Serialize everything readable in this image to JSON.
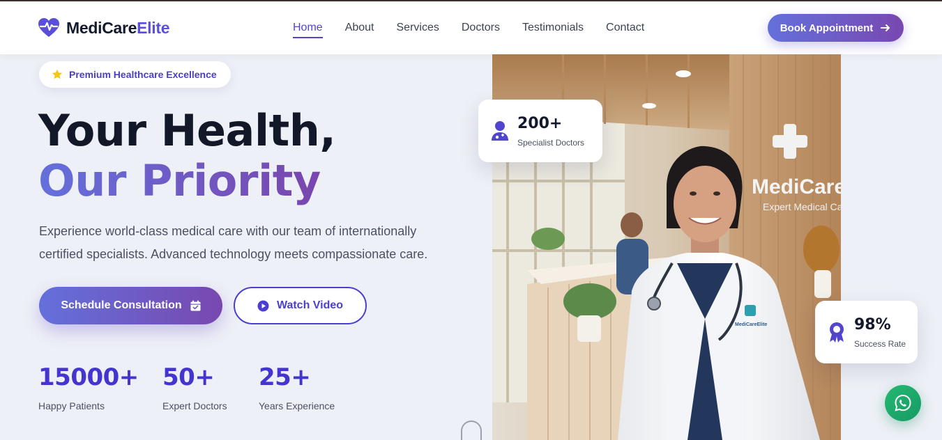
{
  "header": {
    "logo_main": "MediCare",
    "logo_accent": "Elite",
    "nav": [
      {
        "label": "Home",
        "active": true
      },
      {
        "label": "About"
      },
      {
        "label": "Services"
      },
      {
        "label": "Doctors"
      },
      {
        "label": "Testimonials"
      },
      {
        "label": "Contact"
      }
    ],
    "cta_label": "Book Appointment",
    "cta_icon": "arrow-right-icon"
  },
  "hero": {
    "badge": "Premium Healthcare Excellence",
    "badge_icon": "star-icon",
    "title_line1": "Your Health,",
    "title_line2": "Our Priority",
    "description": "Experience world-class medical care with our team of internationally certified specialists. Advanced technology meets compassionate care.",
    "primary_button": "Schedule Consultation",
    "primary_icon": "calendar-check-icon",
    "secondary_button": "Watch Video",
    "secondary_icon": "play-circle-icon",
    "stats": [
      {
        "value": "15000+",
        "label": "Happy Patients"
      },
      {
        "value": "50+",
        "label": "Expert Doctors"
      },
      {
        "value": "25+",
        "label": "Years Experience"
      }
    ]
  },
  "image": {
    "wall_brand": "MediCareElite",
    "wall_tagline": "Expert Medical Care",
    "coat_brand": "MediCareElite"
  },
  "cards": {
    "doctors": {
      "value": "200+",
      "label": "Specialist Doctors",
      "icon": "doctor-icon"
    },
    "success": {
      "value": "98%",
      "label": "Success Rate",
      "icon": "award-icon"
    }
  },
  "floating": {
    "whatsapp_icon": "whatsapp-icon"
  },
  "colors": {
    "accent": "#5145cd",
    "gradient_start": "#6470db",
    "gradient_end": "#7848b0",
    "whatsapp": "#25b46f"
  }
}
